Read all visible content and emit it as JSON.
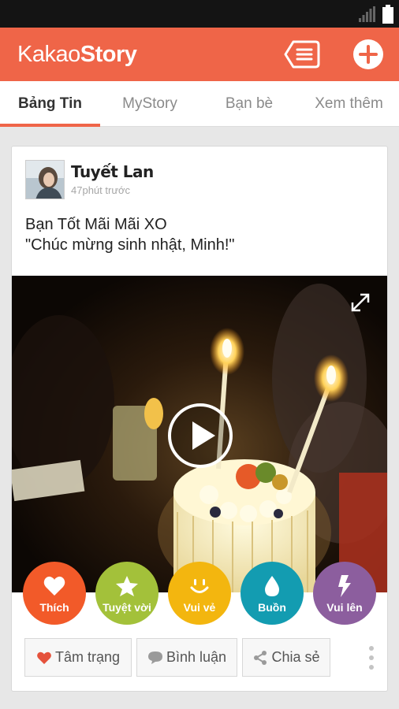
{
  "app": {
    "logo_part1": "Kakao",
    "logo_part2": "Story"
  },
  "tabs": [
    {
      "label": "Bảng Tin"
    },
    {
      "label": "MyStory"
    },
    {
      "label": "Bạn bè"
    },
    {
      "label": "Xem thêm"
    }
  ],
  "post": {
    "author": "Tuyết Lan",
    "time": "47phút trước",
    "text_line1": "Bạn Tốt Mãi Mãi XO",
    "text_line2": "\"Chúc mừng sinh nhật, Minh!\""
  },
  "reactions": [
    {
      "label": "Thích",
      "color": "#f25a29",
      "icon": "heart-icon"
    },
    {
      "label": "Tuyệt vời",
      "color": "#a3c13a",
      "icon": "star-icon"
    },
    {
      "label": "Vui vẻ",
      "color": "#f3b60f",
      "icon": "smile-icon"
    },
    {
      "label": "Buồn",
      "color": "#139cb1",
      "icon": "drop-icon"
    },
    {
      "label": "Vui lên",
      "color": "#8c5e9e",
      "icon": "bolt-icon"
    }
  ],
  "actions": [
    {
      "label": "Tâm trạng",
      "icon": "heart-icon"
    },
    {
      "label": "Bình luận",
      "icon": "comment-icon"
    },
    {
      "label": "Chia sẻ",
      "icon": "share-icon"
    }
  ],
  "colors": {
    "brand": "#ef6548",
    "statusbar": "#141414"
  }
}
